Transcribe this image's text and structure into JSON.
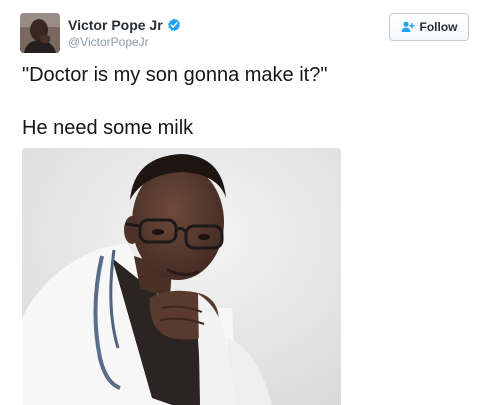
{
  "user": {
    "display_name": "Victor Pope Jr",
    "handle": "@VictorPopeJr",
    "verified": true
  },
  "follow": {
    "label": "Follow",
    "icon": "follow-person-plus-icon"
  },
  "tweet": {
    "lines": [
      "\"Doctor is my son gonna make it?\"",
      "He need some milk"
    ]
  },
  "colors": {
    "text": "#14171a",
    "name": "#292f33",
    "handle": "#8899a6",
    "verified_blue": "#1da1f2",
    "follow_icon": "#1da1f2"
  }
}
